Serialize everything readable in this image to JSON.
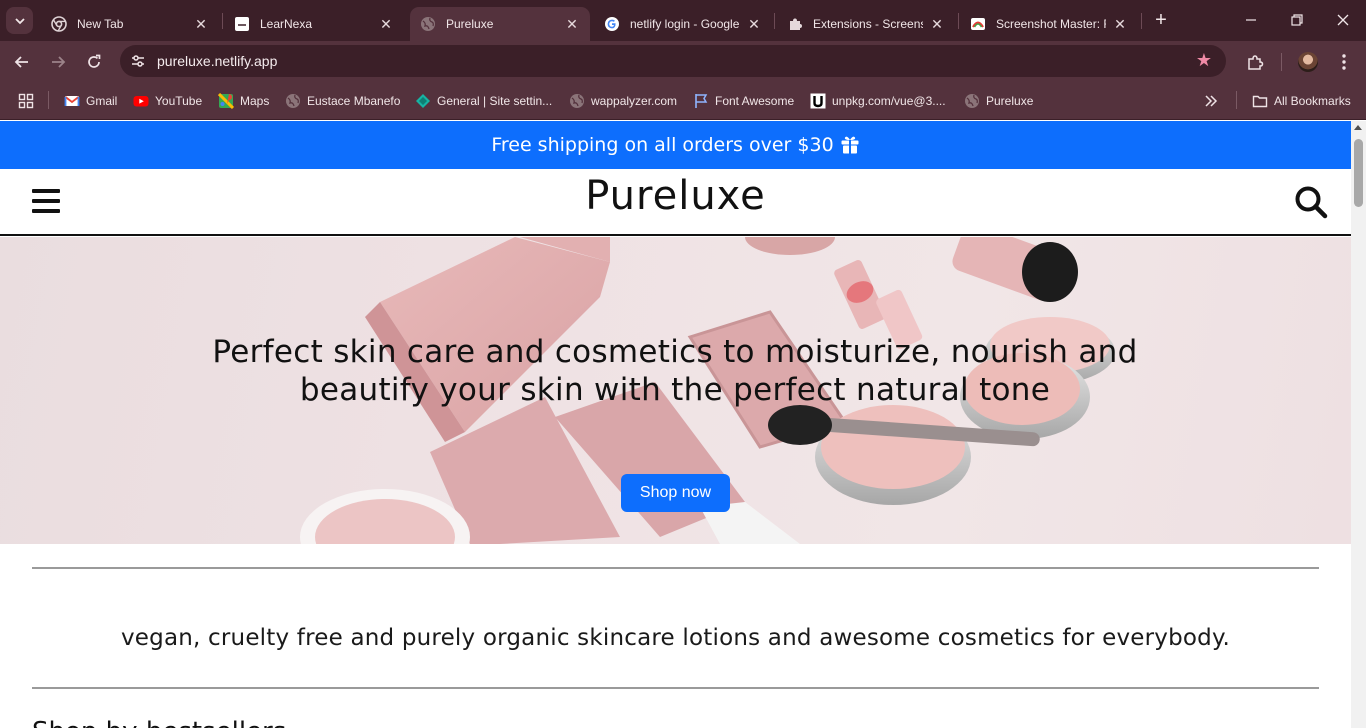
{
  "browser": {
    "tabs": [
      {
        "title": "New Tab",
        "icon": "chrome-icon"
      },
      {
        "title": "LearNexa",
        "icon": "site-favicon"
      },
      {
        "title": "Pureluxe",
        "icon": "globe-icon",
        "active": true
      },
      {
        "title": "netlify login - Google",
        "icon": "google-icon"
      },
      {
        "title": "Extensions - Screensh",
        "icon": "puzzle-icon"
      },
      {
        "title": "Screenshot Master: Fu",
        "icon": "screenshot-master-icon"
      }
    ],
    "url": "pureluxe.netlify.app",
    "bookmarks": [
      {
        "label": "Gmail",
        "icon": "gmail-icon"
      },
      {
        "label": "YouTube",
        "icon": "youtube-icon"
      },
      {
        "label": "Maps",
        "icon": "maps-icon"
      },
      {
        "label": "Eustace Mbanefo",
        "icon": "globe-icon"
      },
      {
        "label": "General | Site settin...",
        "icon": "diamond-icon"
      },
      {
        "label": "wappalyzer.com",
        "icon": "globe-icon"
      },
      {
        "label": "Font Awesome",
        "icon": "flag-icon"
      },
      {
        "label": "unpkg.com/vue@3....",
        "icon": "unpkg-icon"
      },
      {
        "label": "Pureluxe",
        "icon": "globe-icon"
      }
    ],
    "all_bookmarks_label": "All Bookmarks"
  },
  "page": {
    "promo": "Free shipping on all orders over $30",
    "brand": "Pureluxe",
    "hero": {
      "headline": "Perfect skin care and cosmetics to moisturize, nourish and beautify your skin with the perfect natural tone",
      "cta": "Shop now"
    },
    "tagline": "vegan, cruelty free and purely organic skincare lotions and awesome cosmetics for everybody.",
    "section_title": "Shop by bestsellers"
  },
  "colors": {
    "accent": "#0d6efd",
    "chrome_dark": "#3b1f28",
    "chrome_mid": "#54323d"
  }
}
